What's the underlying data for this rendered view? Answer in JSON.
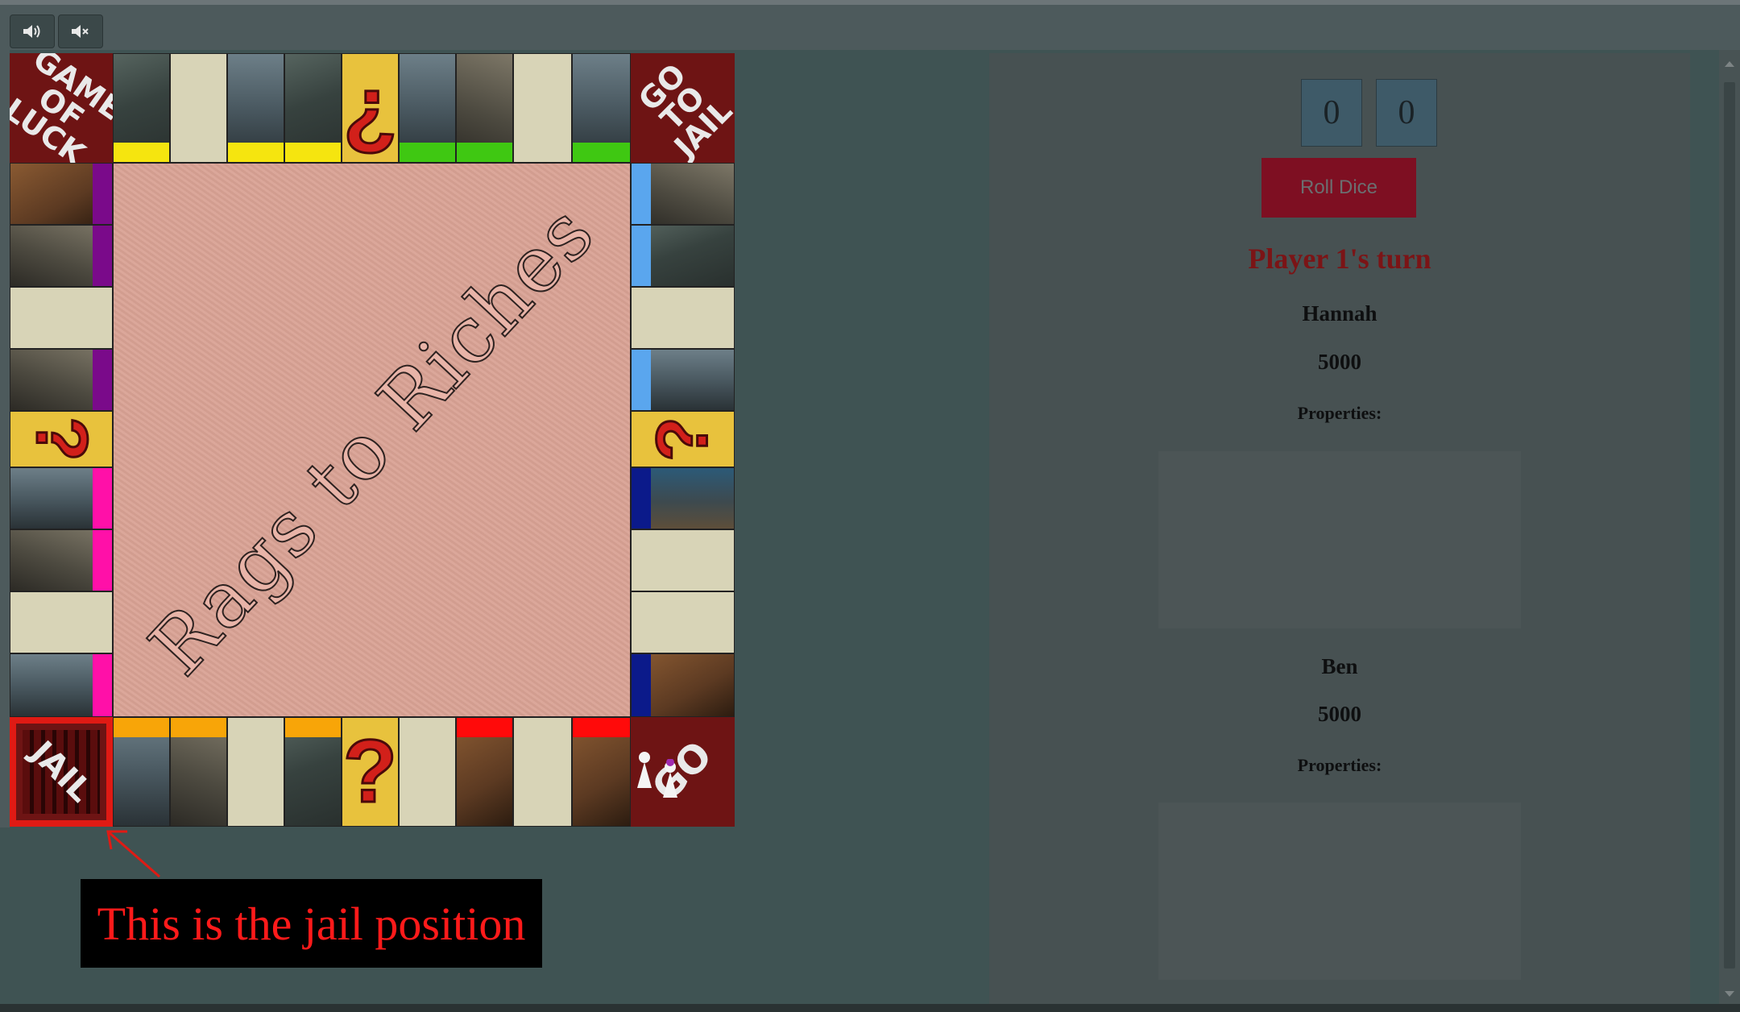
{
  "sound_controls": [
    {
      "name": "sound-on",
      "icon": "speaker-on-icon"
    },
    {
      "name": "sound-off",
      "icon": "speaker-mute-icon"
    }
  ],
  "board": {
    "title": "Rags to Riches",
    "corners": {
      "top_left": "GAME OF LUCK",
      "top_right": "GO TO JAIL",
      "bottom_left": "JAIL",
      "bottom_right": "GO"
    },
    "colors": {
      "yellow": "#f5e50f",
      "green": "#3fc812",
      "purple": "#7a0a8a",
      "pink": "#ff10a8",
      "lightblue": "#5aa6ee",
      "darkblue": "#0b1a8a",
      "orange": "#f8a508",
      "red": "#ff0a0a"
    }
  },
  "annotation": {
    "text": "This is the jail position"
  },
  "dice": [
    "0",
    "0"
  ],
  "roll_button": "Roll Dice",
  "turn_text": "Player 1's turn",
  "players": [
    {
      "name": "Hannah",
      "money": "5000",
      "properties_label": "Properties:"
    },
    {
      "name": "Ben",
      "money": "5000",
      "properties_label": "Properties:"
    }
  ]
}
